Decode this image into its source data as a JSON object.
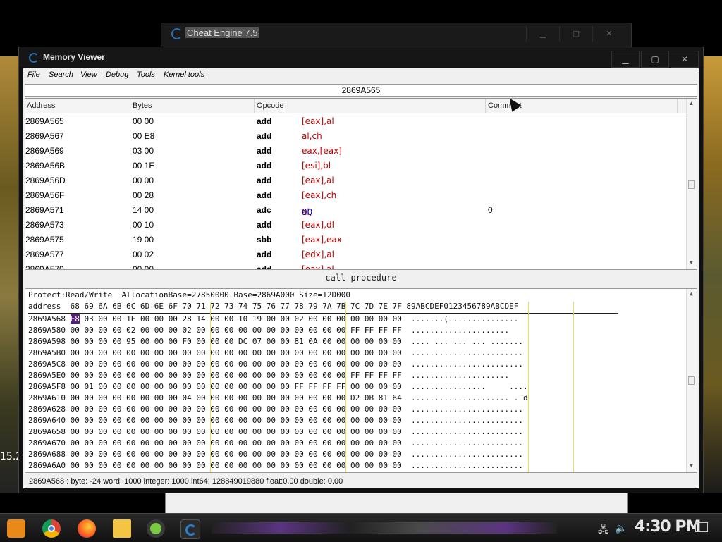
{
  "background": {
    "left_label": "15.2"
  },
  "back_window": {
    "title": "Cheat Engine 7.5",
    "buttons": [
      "▁",
      "▢",
      "✕"
    ]
  },
  "window": {
    "title": "Memory Viewer",
    "buttons": [
      "▁",
      "▢",
      "✕"
    ],
    "menu": [
      "File",
      "Search",
      "View",
      "Debug",
      "Tools",
      "Kernel tools"
    ],
    "address_box": "2869A565",
    "disasm": {
      "columns": [
        "Address",
        "Bytes",
        "Opcode",
        "Comment"
      ],
      "rows": [
        {
          "addr": "2869A565",
          "bytes": "00 00",
          "op": "add",
          "arg": "[eax],al",
          "comment": ""
        },
        {
          "addr": "2869A567",
          "bytes": "00 E8",
          "op": "add",
          "arg": "al,ch",
          "comment": ""
        },
        {
          "addr": "2869A569",
          "bytes": "03 00",
          "op": "add",
          "arg": "eax,[eax]",
          "comment": ""
        },
        {
          "addr": "2869A56B",
          "bytes": "00 1E",
          "op": "add",
          "arg": "[esi],bl",
          "comment": ""
        },
        {
          "addr": "2869A56D",
          "bytes": "00 00",
          "op": "add",
          "arg": "[eax],al",
          "comment": ""
        },
        {
          "addr": "2869A56F",
          "bytes": "00 28",
          "op": "add",
          "arg": "[eax],ch",
          "comment": ""
        },
        {
          "addr": "2869A571",
          "bytes": "14 00",
          "op": "adc",
          "arg": "al,",
          "arg_num": "00",
          "comment": "0"
        },
        {
          "addr": "2869A573",
          "bytes": "00 10",
          "op": "add",
          "arg": "[eax],dl",
          "comment": ""
        },
        {
          "addr": "2869A575",
          "bytes": "19 00",
          "op": "sbb",
          "arg": "[eax],eax",
          "comment": ""
        },
        {
          "addr": "2869A577",
          "bytes": "00 02",
          "op": "add",
          "arg": "[edx],al",
          "comment": ""
        },
        {
          "addr": "2869A579",
          "bytes": "00 00",
          "op": "add",
          "arg": "[eax],al",
          "comment": ""
        }
      ]
    },
    "call_status": "call procedure",
    "hexview": {
      "info": "Protect:Read/Write  AllocationBase=27850000 Base=2869A000 Size=12D000",
      "header": "address  68 69 6A 6B 6C 6D 6E 6F 70 71 72 73 74 75 76 77 78 79 7A 7B 7C 7D 7E 7F 89ABCDEF0123456789ABCDEF",
      "first_row_addr": "2869A568",
      "first_row_hilite": "E8",
      "first_row_rest": " 03 00 00 1E 00 00 00 28 14 00 00 10 19 00 00 02 00 00 00 00 00 00 00  .......(...............",
      "rows": [
        "2869A580 00 00 00 00 02 00 00 00 02 00 00 00 00 00 00 00 00 00 00 00 FF FF FF FF  .....................",
        "2869A598 00 00 00 00 95 00 00 00 F0 00 00 00 DC 07 00 00 81 0A 00 00 00 00 00 00  .... ... ... ... .......",
        "2869A5B0 00 00 00 00 00 00 00 00 00 00 00 00 00 00 00 00 00 00 00 00 00 00 00 00  ........................",
        "2869A5C8 00 00 00 00 00 00 00 00 00 00 00 00 00 00 00 00 00 00 00 00 00 00 00 00  ........................",
        "2869A5E0 00 00 00 00 00 00 00 00 00 00 00 00 00 00 00 00 00 00 00 00 FF FF FF FF  .....................",
        "2869A5F8 00 01 00 00 00 00 00 00 00 00 00 00 00 00 00 00 FF FF FF FF 00 00 00 00  ................     ....",
        "2869A610 00 00 00 00 00 00 00 00 04 00 00 00 00 00 00 00 00 00 00 00 D2 0B 81 64  ..................... . d",
        "2869A628 00 00 00 00 00 00 00 00 00 00 00 00 00 00 00 00 00 00 00 00 00 00 00 00  ........................",
        "2869A640 00 00 00 00 00 00 00 00 00 00 00 00 00 00 00 00 00 00 00 00 00 00 00 00  ........................",
        "2869A658 00 00 00 00 00 00 00 00 00 00 00 00 00 00 00 00 00 00 00 00 00 00 00 00  ........................",
        "2869A670 00 00 00 00 00 00 00 00 00 00 00 00 00 00 00 00 00 00 00 00 00 00 00 00  ........................",
        "2869A688 00 00 00 00 00 00 00 00 00 00 00 00 00 00 00 00 00 00 00 00 00 00 00 00  ........................",
        "2869A6A0 00 00 00 00 00 00 00 00 00 00 00 00 00 00 00 00 00 00 00 00 00 00 00 00  ........................"
      ]
    },
    "status_bar": "2869A568 : byte: -24 word: 1000 integer: 1000 int64: 128849019880 float:0.00 double: 0.00"
  },
  "taskbar": {
    "apps": [
      "start-icon",
      "chrome-icon",
      "firefox-icon",
      "folder-icon",
      "game-icon",
      "cheat-engine-icon"
    ],
    "clock": "4:30 PM",
    "tray": [
      "network-icon",
      "volume-icon"
    ]
  }
}
